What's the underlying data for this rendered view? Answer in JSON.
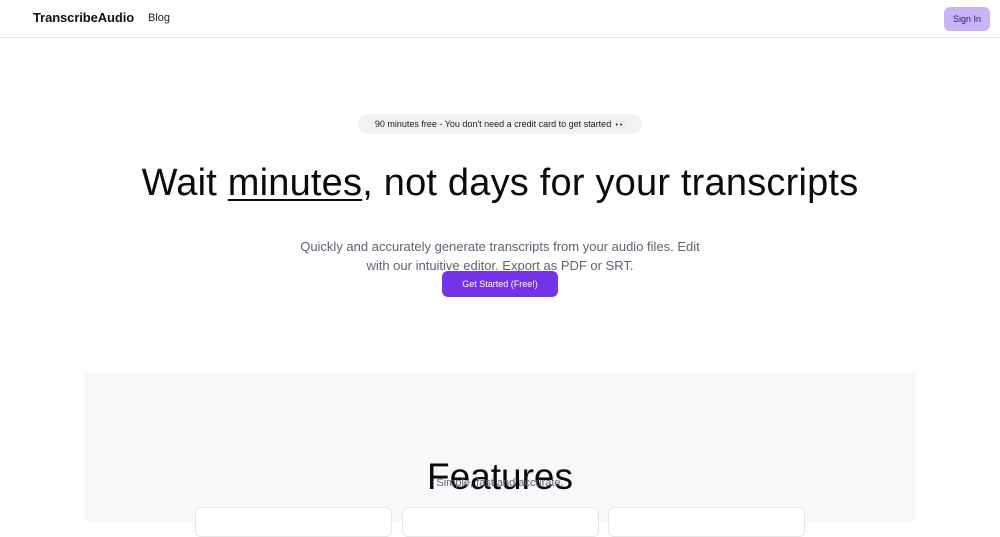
{
  "header": {
    "brand": "TranscribeAudio",
    "nav": {
      "blog": "Blog"
    },
    "sign_in": "Sign In"
  },
  "hero": {
    "pill_text": "90 minutes free - You don't need a credit card to get started",
    "pill_emoji": "👀",
    "title_before": "Wait ",
    "title_emphasis": "minutes",
    "title_after": ", not days for your transcripts",
    "subtitle": "Quickly and accurately generate transcripts from your audio files. Edit with our intuitive editor. Export as PDF or SRT.",
    "cta": "Get Started (Free!)"
  },
  "features": {
    "title": "Features",
    "subtitle": "Simple, fast and accurate."
  },
  "colors": {
    "accent": "#7433e6",
    "sign_in_bg": "#c8b5f7",
    "features_bg": "#f7f8fa"
  }
}
